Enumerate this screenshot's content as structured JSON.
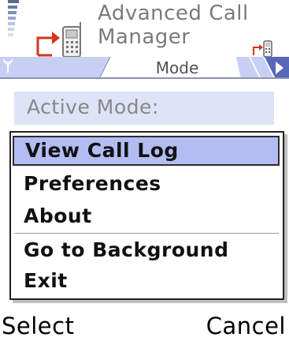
{
  "header": {
    "title_line1": "Advanced Call",
    "title_line2": "Manager"
  },
  "tabs": {
    "active_tab": "Mode"
  },
  "content": {
    "active_mode_label": "Active Mode:"
  },
  "menu": {
    "items": [
      {
        "label": "View Call Log",
        "selected": true
      },
      {
        "label": "Preferences",
        "selected": false
      },
      {
        "label": "About",
        "selected": false
      },
      {
        "label": "Go to Background",
        "selected": false
      },
      {
        "label": "Exit",
        "selected": false
      }
    ]
  },
  "softkeys": {
    "left": "Select",
    "right": "Cancel"
  },
  "colors": {
    "selection": "#b3bdf2",
    "tab_highlight": "#c7cff3",
    "active_mode_bg": "#dfe3f7"
  },
  "icons": [
    "signal-strength-icon",
    "call-forward-phone-icon",
    "small-phone-icon",
    "antenna-icon",
    "tab-scroll-right-icon"
  ]
}
